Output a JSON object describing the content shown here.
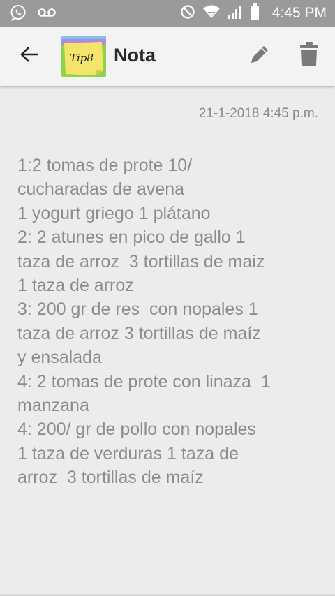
{
  "status_bar": {
    "time": "4:45 PM",
    "icons": [
      "whatsapp-icon",
      "voicemail-icon",
      "do-not-disturb-icon",
      "wifi-icon",
      "signal-icon",
      "battery-icon"
    ]
  },
  "app_bar": {
    "title": "Nota",
    "logo_text": "Tip8",
    "icons": [
      "back-arrow-icon",
      "pencil-icon",
      "trash-icon"
    ]
  },
  "note": {
    "date": "21-1-2018 4:45 p.m.",
    "body": "1:2 tomas de prote 10/\ncucharadas de avena\n1 yogurt griego 1 plátano\n2: 2 atunes en pico de gallo 1\ntaza de arroz  3 tortillas de maiz\n1 taza de arroz\n3: 200 gr de res  con nopales 1\ntaza de arroz 3 tortillas de maíz\ny ensalada\n4: 2 tomas de prote con linaza  1\nmanzana\n4: 200/ gr de pollo con nopales\n1 taza de verduras 1 taza de\narroz  3 tortillas de maíz"
  },
  "colors": {
    "status_bar": "#9a9a9a",
    "app_bar": "#f3f3f3",
    "background": "#ececec",
    "note_text": "#8d8d8d",
    "icon_gray": "#7a7a7a"
  }
}
